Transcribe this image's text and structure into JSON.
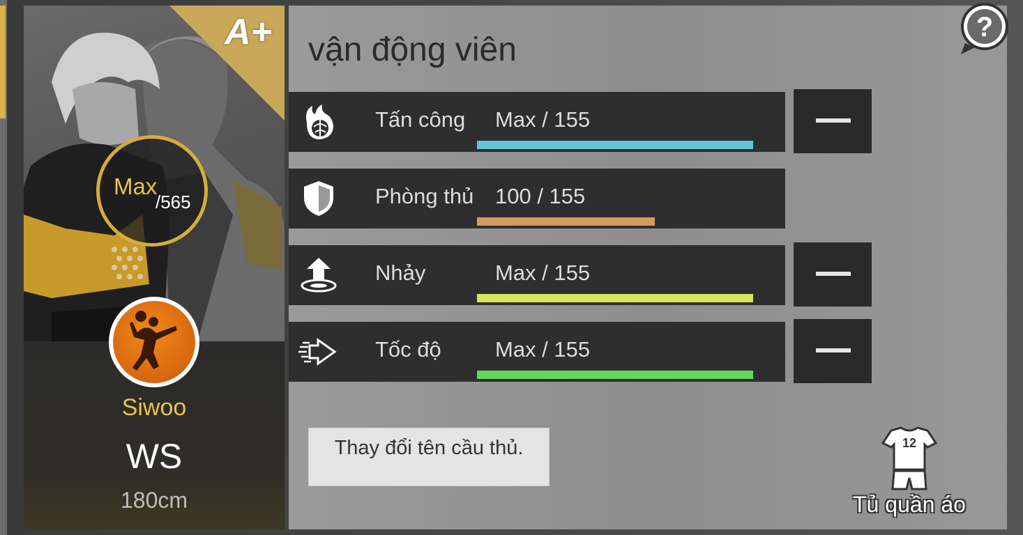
{
  "card": {
    "grade": "A+",
    "ovr_current": "Max",
    "ovr_total": "/565",
    "name": "Siwoo",
    "position": "WS",
    "height": "180cm",
    "position_icon": "spike-player-icon"
  },
  "panel": {
    "title": "vận động viên",
    "stats": [
      {
        "label": "Tấn công",
        "value": "Max / 155",
        "current": 155,
        "max": 155,
        "color": "#5fc4d8",
        "icon": "fire-ball-icon"
      },
      {
        "label": "Phòng thủ",
        "value": "100 / 155",
        "current": 100,
        "max": 155,
        "color": "#d49a5c",
        "icon": "shield-icon"
      },
      {
        "label": "Nhảy",
        "value": "Max / 155",
        "current": 155,
        "max": 155,
        "color": "#d6e55a",
        "icon": "jump-arrow-icon"
      },
      {
        "label": "Tốc độ",
        "value": "Max / 155",
        "current": 155,
        "max": 155,
        "color": "#63d85a",
        "icon": "speed-arrow-icon"
      }
    ],
    "rename_button": "Thay đổi tên cầu thủ.",
    "wardrobe": {
      "label": "Tủ quần áo",
      "jersey_number": "12",
      "icon": "jersey-icon"
    }
  },
  "help": {
    "icon": "help-question-icon"
  }
}
